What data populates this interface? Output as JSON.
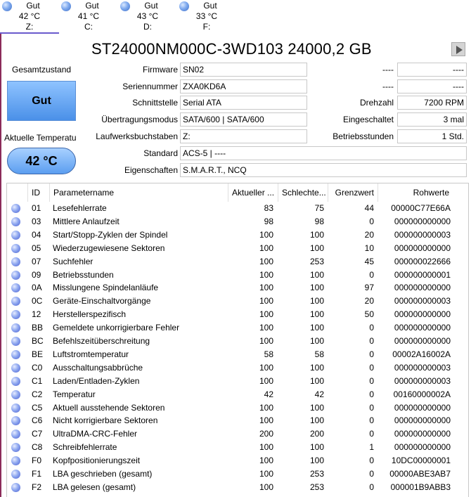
{
  "drives": [
    {
      "status": "Gut",
      "temp": "42 °C",
      "letter": "Z:",
      "active": true
    },
    {
      "status": "Gut",
      "temp": "41 °C",
      "letter": "C:",
      "active": false
    },
    {
      "status": "Gut",
      "temp": "43 °C",
      "letter": "D:",
      "active": false
    },
    {
      "status": "Gut",
      "temp": "33 °C",
      "letter": "F:",
      "active": false
    }
  ],
  "title": "ST24000NM000C-3WD103 24000,2 GB",
  "health": {
    "label": "Gesamtzustand",
    "value": "Gut"
  },
  "temperature": {
    "label": "Aktuelle Temperatu",
    "value": "42 °C"
  },
  "info": {
    "firmware": {
      "label": "Firmware",
      "value": "SN02"
    },
    "serial": {
      "label": "Seriennummer",
      "value": "ZXA0KD6A"
    },
    "interface": {
      "label": "Schnittstelle",
      "value": "Serial ATA"
    },
    "transfer": {
      "label": "Übertragungsmodus",
      "value": "SATA/600 | SATA/600"
    },
    "letters": {
      "label": "Laufwerksbuchstaben",
      "value": "Z:"
    },
    "standard": {
      "label": "Standard",
      "value": "ACS-5 | ----"
    },
    "features": {
      "label": "Eigenschaften",
      "value": "S.M.A.R.T., NCQ"
    },
    "right1": {
      "label": "----",
      "value": "----"
    },
    "right2": {
      "label": "----",
      "value": "----"
    },
    "rpm": {
      "label": "Drehzahl",
      "value": "7200 RPM"
    },
    "power_count": {
      "label": "Eingeschaltet",
      "value": "3 mal"
    },
    "power_hours": {
      "label": "Betriebsstunden",
      "value": "1 Std."
    }
  },
  "table": {
    "headers": {
      "id": "ID",
      "name": "Parametername",
      "current": "Aktueller ...",
      "worst": "Schlechte...",
      "threshold": "Grenzwert",
      "raw": "Rohwerte"
    },
    "rows": [
      {
        "id": "01",
        "name": "Lesefehlerrate",
        "current": "83",
        "worst": "75",
        "threshold": "44",
        "raw": "00000C77E66A"
      },
      {
        "id": "03",
        "name": "Mittlere Anlaufzeit",
        "current": "98",
        "worst": "98",
        "threshold": "0",
        "raw": "000000000000"
      },
      {
        "id": "04",
        "name": "Start/Stopp-Zyklen der Spindel",
        "current": "100",
        "worst": "100",
        "threshold": "20",
        "raw": "000000000003"
      },
      {
        "id": "05",
        "name": "Wiederzugewiesene Sektoren",
        "current": "100",
        "worst": "100",
        "threshold": "10",
        "raw": "000000000000"
      },
      {
        "id": "07",
        "name": "Suchfehler",
        "current": "100",
        "worst": "253",
        "threshold": "45",
        "raw": "000000022666"
      },
      {
        "id": "09",
        "name": "Betriebsstunden",
        "current": "100",
        "worst": "100",
        "threshold": "0",
        "raw": "000000000001"
      },
      {
        "id": "0A",
        "name": "Misslungene Spindelanläufe",
        "current": "100",
        "worst": "100",
        "threshold": "97",
        "raw": "000000000000"
      },
      {
        "id": "0C",
        "name": "Geräte-Einschaltvorgänge",
        "current": "100",
        "worst": "100",
        "threshold": "20",
        "raw": "000000000003"
      },
      {
        "id": "12",
        "name": "Herstellerspezifisch",
        "current": "100",
        "worst": "100",
        "threshold": "50",
        "raw": "000000000000"
      },
      {
        "id": "BB",
        "name": "Gemeldete unkorrigierbare Fehler",
        "current": "100",
        "worst": "100",
        "threshold": "0",
        "raw": "000000000000"
      },
      {
        "id": "BC",
        "name": "Befehlszeitüberschreitung",
        "current": "100",
        "worst": "100",
        "threshold": "0",
        "raw": "000000000000"
      },
      {
        "id": "BE",
        "name": "Luftstromtemperatur",
        "current": "58",
        "worst": "58",
        "threshold": "0",
        "raw": "00002A16002A"
      },
      {
        "id": "C0",
        "name": "Ausschaltungsabbrüche",
        "current": "100",
        "worst": "100",
        "threshold": "0",
        "raw": "000000000003"
      },
      {
        "id": "C1",
        "name": "Laden/Entladen-Zyklen",
        "current": "100",
        "worst": "100",
        "threshold": "0",
        "raw": "000000000003"
      },
      {
        "id": "C2",
        "name": "Temperatur",
        "current": "42",
        "worst": "42",
        "threshold": "0",
        "raw": "00160000002A"
      },
      {
        "id": "C5",
        "name": "Aktuell ausstehende Sektoren",
        "current": "100",
        "worst": "100",
        "threshold": "0",
        "raw": "000000000000"
      },
      {
        "id": "C6",
        "name": "Nicht korrigierbare Sektoren",
        "current": "100",
        "worst": "100",
        "threshold": "0",
        "raw": "000000000000"
      },
      {
        "id": "C7",
        "name": "UltraDMA-CRC-Fehler",
        "current": "200",
        "worst": "200",
        "threshold": "0",
        "raw": "000000000000"
      },
      {
        "id": "C8",
        "name": "Schreibfehlerrate",
        "current": "100",
        "worst": "100",
        "threshold": "1",
        "raw": "000000000000"
      },
      {
        "id": "F0",
        "name": "Kopfpositionierungszeit",
        "current": "100",
        "worst": "100",
        "threshold": "0",
        "raw": "10DC00000001"
      },
      {
        "id": "F1",
        "name": "LBA geschrieben (gesamt)",
        "current": "100",
        "worst": "253",
        "threshold": "0",
        "raw": "00000ABE3AB7"
      },
      {
        "id": "F2",
        "name": "LBA gelesen (gesamt)",
        "current": "100",
        "worst": "253",
        "threshold": "0",
        "raw": "000001B9ABB3"
      }
    ]
  }
}
